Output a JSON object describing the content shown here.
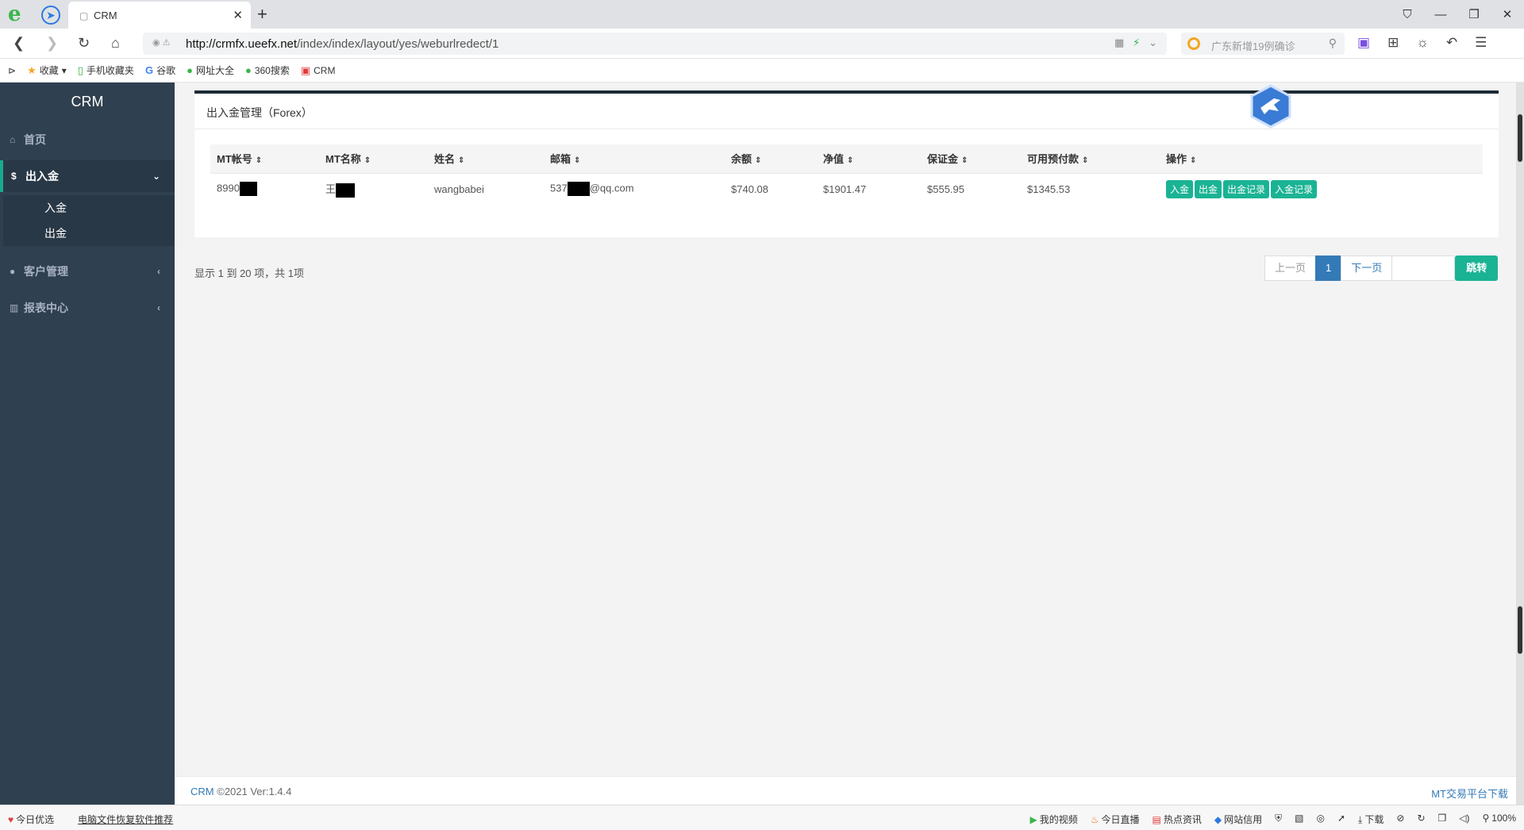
{
  "browser": {
    "tab_title": "CRM",
    "url_host": "http://crmfx.ueefx.net",
    "url_path": "/index/index/layout/yes/weburlredect/1",
    "search_placeholder": "广东新增19例确诊",
    "bookmarks": [
      "收藏",
      "手机收藏夹",
      "谷歌",
      "网址大全",
      "360搜索",
      "CRM"
    ]
  },
  "sidebar": {
    "brand": "CRM",
    "items": [
      {
        "label": "首页"
      },
      {
        "label": "出入金"
      },
      {
        "label": "客户管理"
      },
      {
        "label": "报表中心"
      }
    ],
    "sub_items": [
      {
        "label": "入金"
      },
      {
        "label": "出金"
      }
    ]
  },
  "panel": {
    "title": "出入金管理（Forex）"
  },
  "table": {
    "headers": [
      "MT帐号",
      "MT名称",
      "姓名",
      "邮箱",
      "余额",
      "净值",
      "保证金",
      "可用预付款",
      "操作"
    ],
    "rows": [
      {
        "mt_account": "8990",
        "mt_name": "王",
        "name": "wangbabei",
        "email_prefix": "537",
        "email_suffix": "@qq.com",
        "balance": "$740.08",
        "equity": "$1901.47",
        "margin": "$555.95",
        "free_margin": "$1345.53",
        "actions": [
          "入金",
          "出金",
          "出金记录",
          "入金记录"
        ]
      }
    ]
  },
  "pagination": {
    "summary": "显示 1 到 20 项，共 1项",
    "prev": "上一页",
    "current": "1",
    "next": "下一页",
    "jump": "跳转"
  },
  "footer": {
    "brand": "CRM",
    "copyright": "©2021 Ver:1.4.4",
    "download": "MT交易平台下载"
  },
  "statusbar": {
    "left": [
      "今日优选",
      "电脑文件恢复软件推荐"
    ],
    "right": [
      "我的视频",
      "今日直播",
      "热点资讯",
      "网站信用",
      "下载",
      "100%"
    ]
  },
  "colors": {
    "sidebar_bg": "#2f4050",
    "accent_green": "#1ab394",
    "primary_blue": "#337ab7"
  }
}
